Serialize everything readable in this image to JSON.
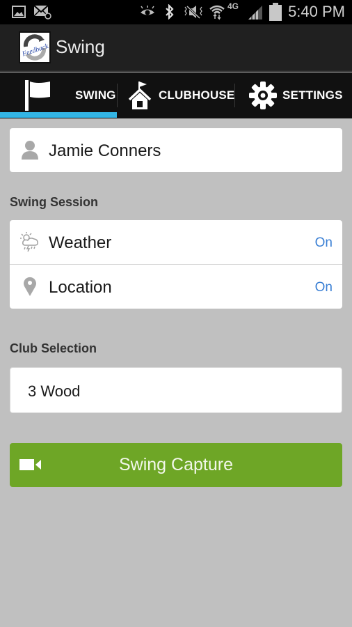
{
  "status_bar": {
    "time": "5:40 PM",
    "network": "4G",
    "icons": [
      "gallery-icon",
      "email-icon",
      "eye-icon",
      "bluetooth-icon",
      "mute-vibrate-icon",
      "wifi-icon",
      "4g-icon",
      "signal-icon",
      "battery-icon"
    ]
  },
  "action_bar": {
    "logo_text": "Feedback",
    "title": "Swing"
  },
  "tabs": [
    {
      "label": "SWING",
      "icon": "flag-icon",
      "selected": true
    },
    {
      "label": "CLUBHOUSE",
      "icon": "clubhouse-icon",
      "selected": false
    },
    {
      "label": "SETTINGS",
      "icon": "gear-icon",
      "selected": false
    }
  ],
  "colors": {
    "tab_indicator": "#33b5e5",
    "toggle_value": "#3a7fd4",
    "capture_button": "#6ea626",
    "background": "#c0c0c0"
  },
  "user": {
    "name": "Jamie Conners",
    "icon": "person-icon"
  },
  "swing_session": {
    "title": "Swing Session",
    "rows": [
      {
        "label": "Weather",
        "value": "On",
        "icon": "weather-icon"
      },
      {
        "label": "Location",
        "value": "On",
        "icon": "location-pin-icon"
      }
    ]
  },
  "club_selection": {
    "title": "Club Selection",
    "value": "3 Wood"
  },
  "capture": {
    "label": "Swing Capture",
    "icon": "video-camera-icon"
  }
}
